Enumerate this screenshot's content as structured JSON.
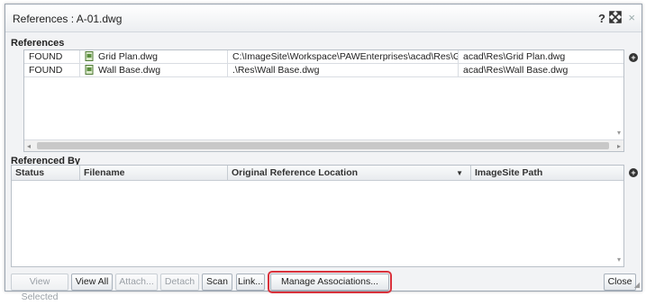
{
  "window": {
    "title": "References : A-01.dwg",
    "help_icon": "?",
    "close_icon": "×"
  },
  "references": {
    "label": "References",
    "rows": [
      {
        "status": "FOUND",
        "filename": "Grid Plan.dwg",
        "location": "C:\\ImageSite\\Workspace\\PAWEnterprises\\acad\\Res\\Grid Pl...",
        "path": "acad\\Res\\Grid Plan.dwg"
      },
      {
        "status": "FOUND",
        "filename": "Wall Base.dwg",
        "location": ".\\Res\\Wall Base.dwg",
        "path": "acad\\Res\\Wall Base.dwg"
      }
    ]
  },
  "referenced_by": {
    "label": "Referenced By",
    "columns": [
      "Status",
      "Filename",
      "Original Reference Location",
      "ImageSite Path"
    ]
  },
  "buttons": {
    "view_selected": "View Selected",
    "view_all": "View All",
    "attach": "Attach...",
    "detach": "Detach",
    "scan": "Scan",
    "link": "Link...",
    "manage_associations": "Manage Associations...",
    "close": "Close"
  },
  "colors": {
    "highlight": "#d9313b",
    "border": "#b9c0c8"
  }
}
